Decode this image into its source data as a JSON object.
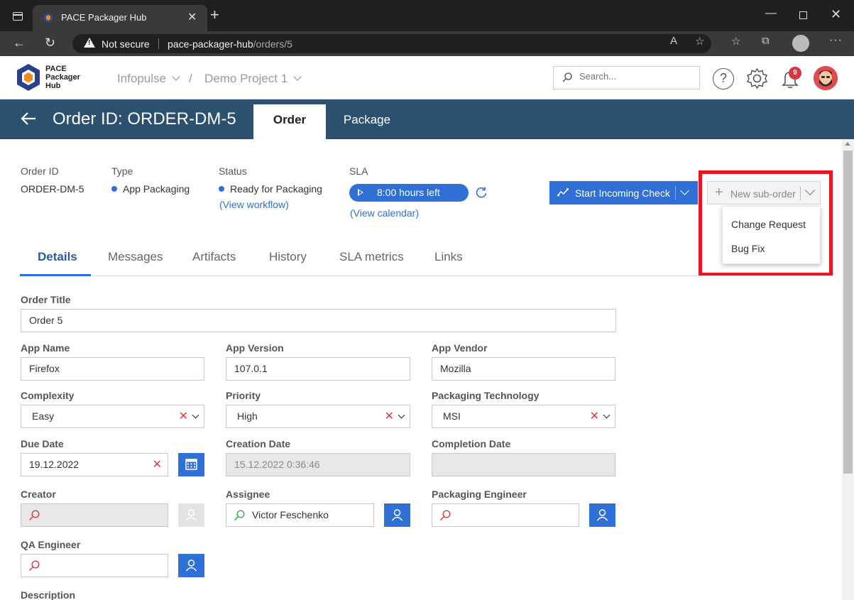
{
  "browser": {
    "tab_title": "PACE Packager Hub",
    "security_label": "Not secure",
    "url_host": "pace-packager-hub",
    "url_path": "/orders/5"
  },
  "header": {
    "logo_lines": [
      "PACE",
      "Packager",
      "Hub"
    ],
    "breadcrumb_org": "Infopulse",
    "breadcrumb_sep": "/",
    "breadcrumb_project": "Demo Project 1",
    "search_placeholder": "Search...",
    "notification_count": "9"
  },
  "banner": {
    "title": "Order ID: ORDER-DM-5",
    "tabs": [
      {
        "label": "Order",
        "active": true
      },
      {
        "label": "Package",
        "active": false
      }
    ]
  },
  "info": {
    "order_id_label": "Order ID",
    "order_id_value": "ORDER-DM-5",
    "type_label": "Type",
    "type_value": "App Packaging",
    "status_label": "Status",
    "status_value": "Ready for Packaging",
    "status_link": "(View workflow)",
    "sla_label": "SLA",
    "sla_value": "8:00 hours left",
    "sla_link": "(View calendar)"
  },
  "actions": {
    "start_incoming_check": "Start Incoming Check",
    "new_sub_order": "New sub-order",
    "sub_order_menu": [
      "Change Request",
      "Bug Fix"
    ]
  },
  "detail_tabs": [
    {
      "label": "Details",
      "active": true
    },
    {
      "label": "Messages",
      "active": false
    },
    {
      "label": "Artifacts",
      "active": false
    },
    {
      "label": "History",
      "active": false
    },
    {
      "label": "SLA metrics",
      "active": false
    },
    {
      "label": "Links",
      "active": false
    }
  ],
  "form": {
    "order_title_label": "Order Title",
    "order_title": "Order 5",
    "app_name_label": "App Name",
    "app_name": "Firefox",
    "app_version_label": "App Version",
    "app_version": "107.0.1",
    "app_vendor_label": "App Vendor",
    "app_vendor": "Mozilla",
    "complexity_label": "Complexity",
    "complexity": "Easy",
    "priority_label": "Priority",
    "priority": "High",
    "packaging_tech_label": "Packaging Technology",
    "packaging_tech": "MSI",
    "due_date_label": "Due Date",
    "due_date": "19.12.2022",
    "creation_date_label": "Creation Date",
    "creation_date": "15.12.2022 0:36:46",
    "completion_date_label": "Completion Date",
    "completion_date": "",
    "creator_label": "Creator",
    "creator": "",
    "assignee_label": "Assignee",
    "assignee": "Victor Feschenko",
    "packaging_engineer_label": "Packaging Engineer",
    "packaging_engineer": "",
    "qa_engineer_label": "QA Engineer",
    "qa_engineer": "",
    "description_label": "Description"
  },
  "colors": {
    "banner": "#2c5070",
    "accent": "#2f6fd6",
    "highlight": "#e8141f"
  }
}
